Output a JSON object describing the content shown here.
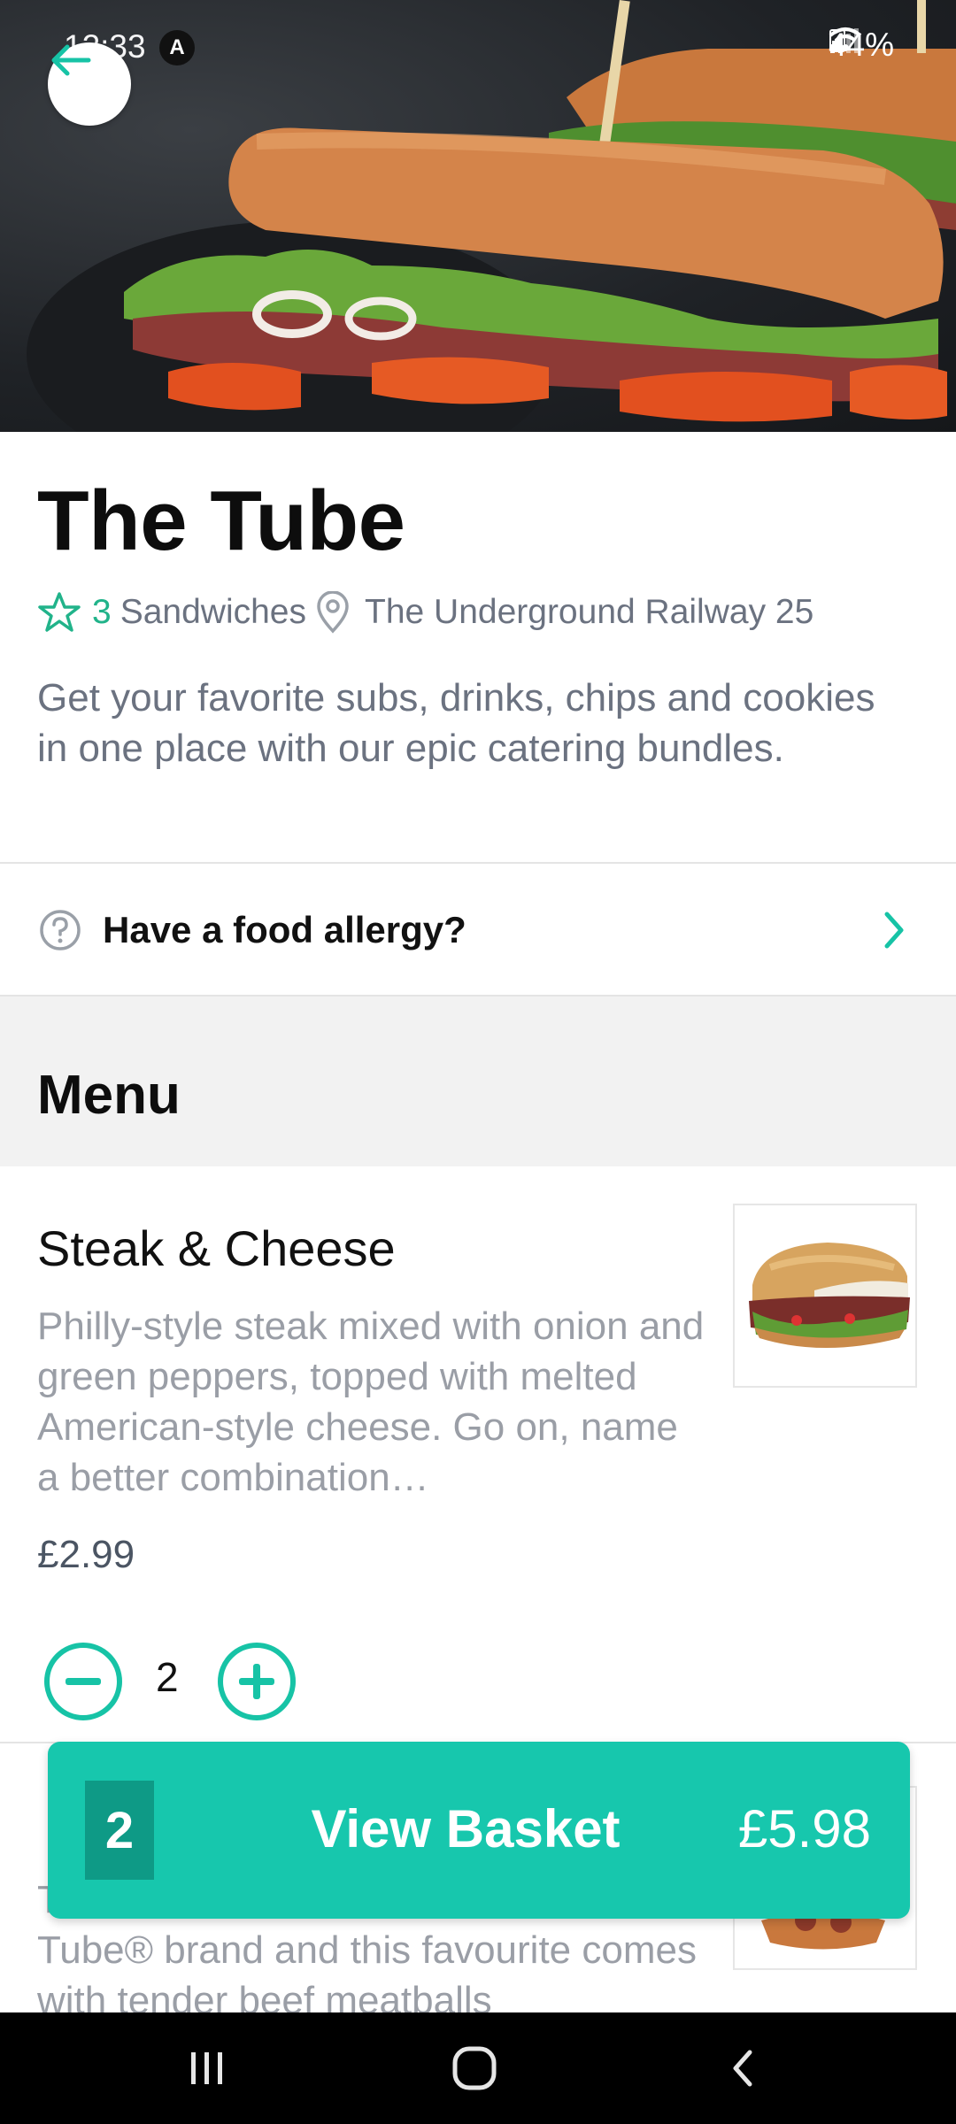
{
  "status_bar": {
    "time": "12:33",
    "battery": "44%"
  },
  "restaurant": {
    "name": "The Tube",
    "count": "3",
    "category": "Sandwiches",
    "address": "The Underground Railway 25",
    "description": "Get your favorite subs, drinks, chips and cookies in one place with our epic catering bundles."
  },
  "allergy": {
    "label": "Have a food allergy?"
  },
  "menu": {
    "header": "Menu",
    "items": [
      {
        "name": "Steak & Cheese",
        "description": "Philly-style steak mixed with onion and green peppers, topped with melted American-style cheese. Go on, name a better combination…",
        "price": "£2.99",
        "quantity": "2"
      },
      {
        "description": "The Meatball Marinara is iconic to the Tube® brand and this favourite comes with tender beef meatballs"
      }
    ]
  },
  "basket": {
    "count": "2",
    "label": "View Basket",
    "total": "£5.98"
  },
  "colors": {
    "accent": "#17c7ad",
    "accent_dark": "#0e9a86",
    "star": "#21b38a"
  }
}
